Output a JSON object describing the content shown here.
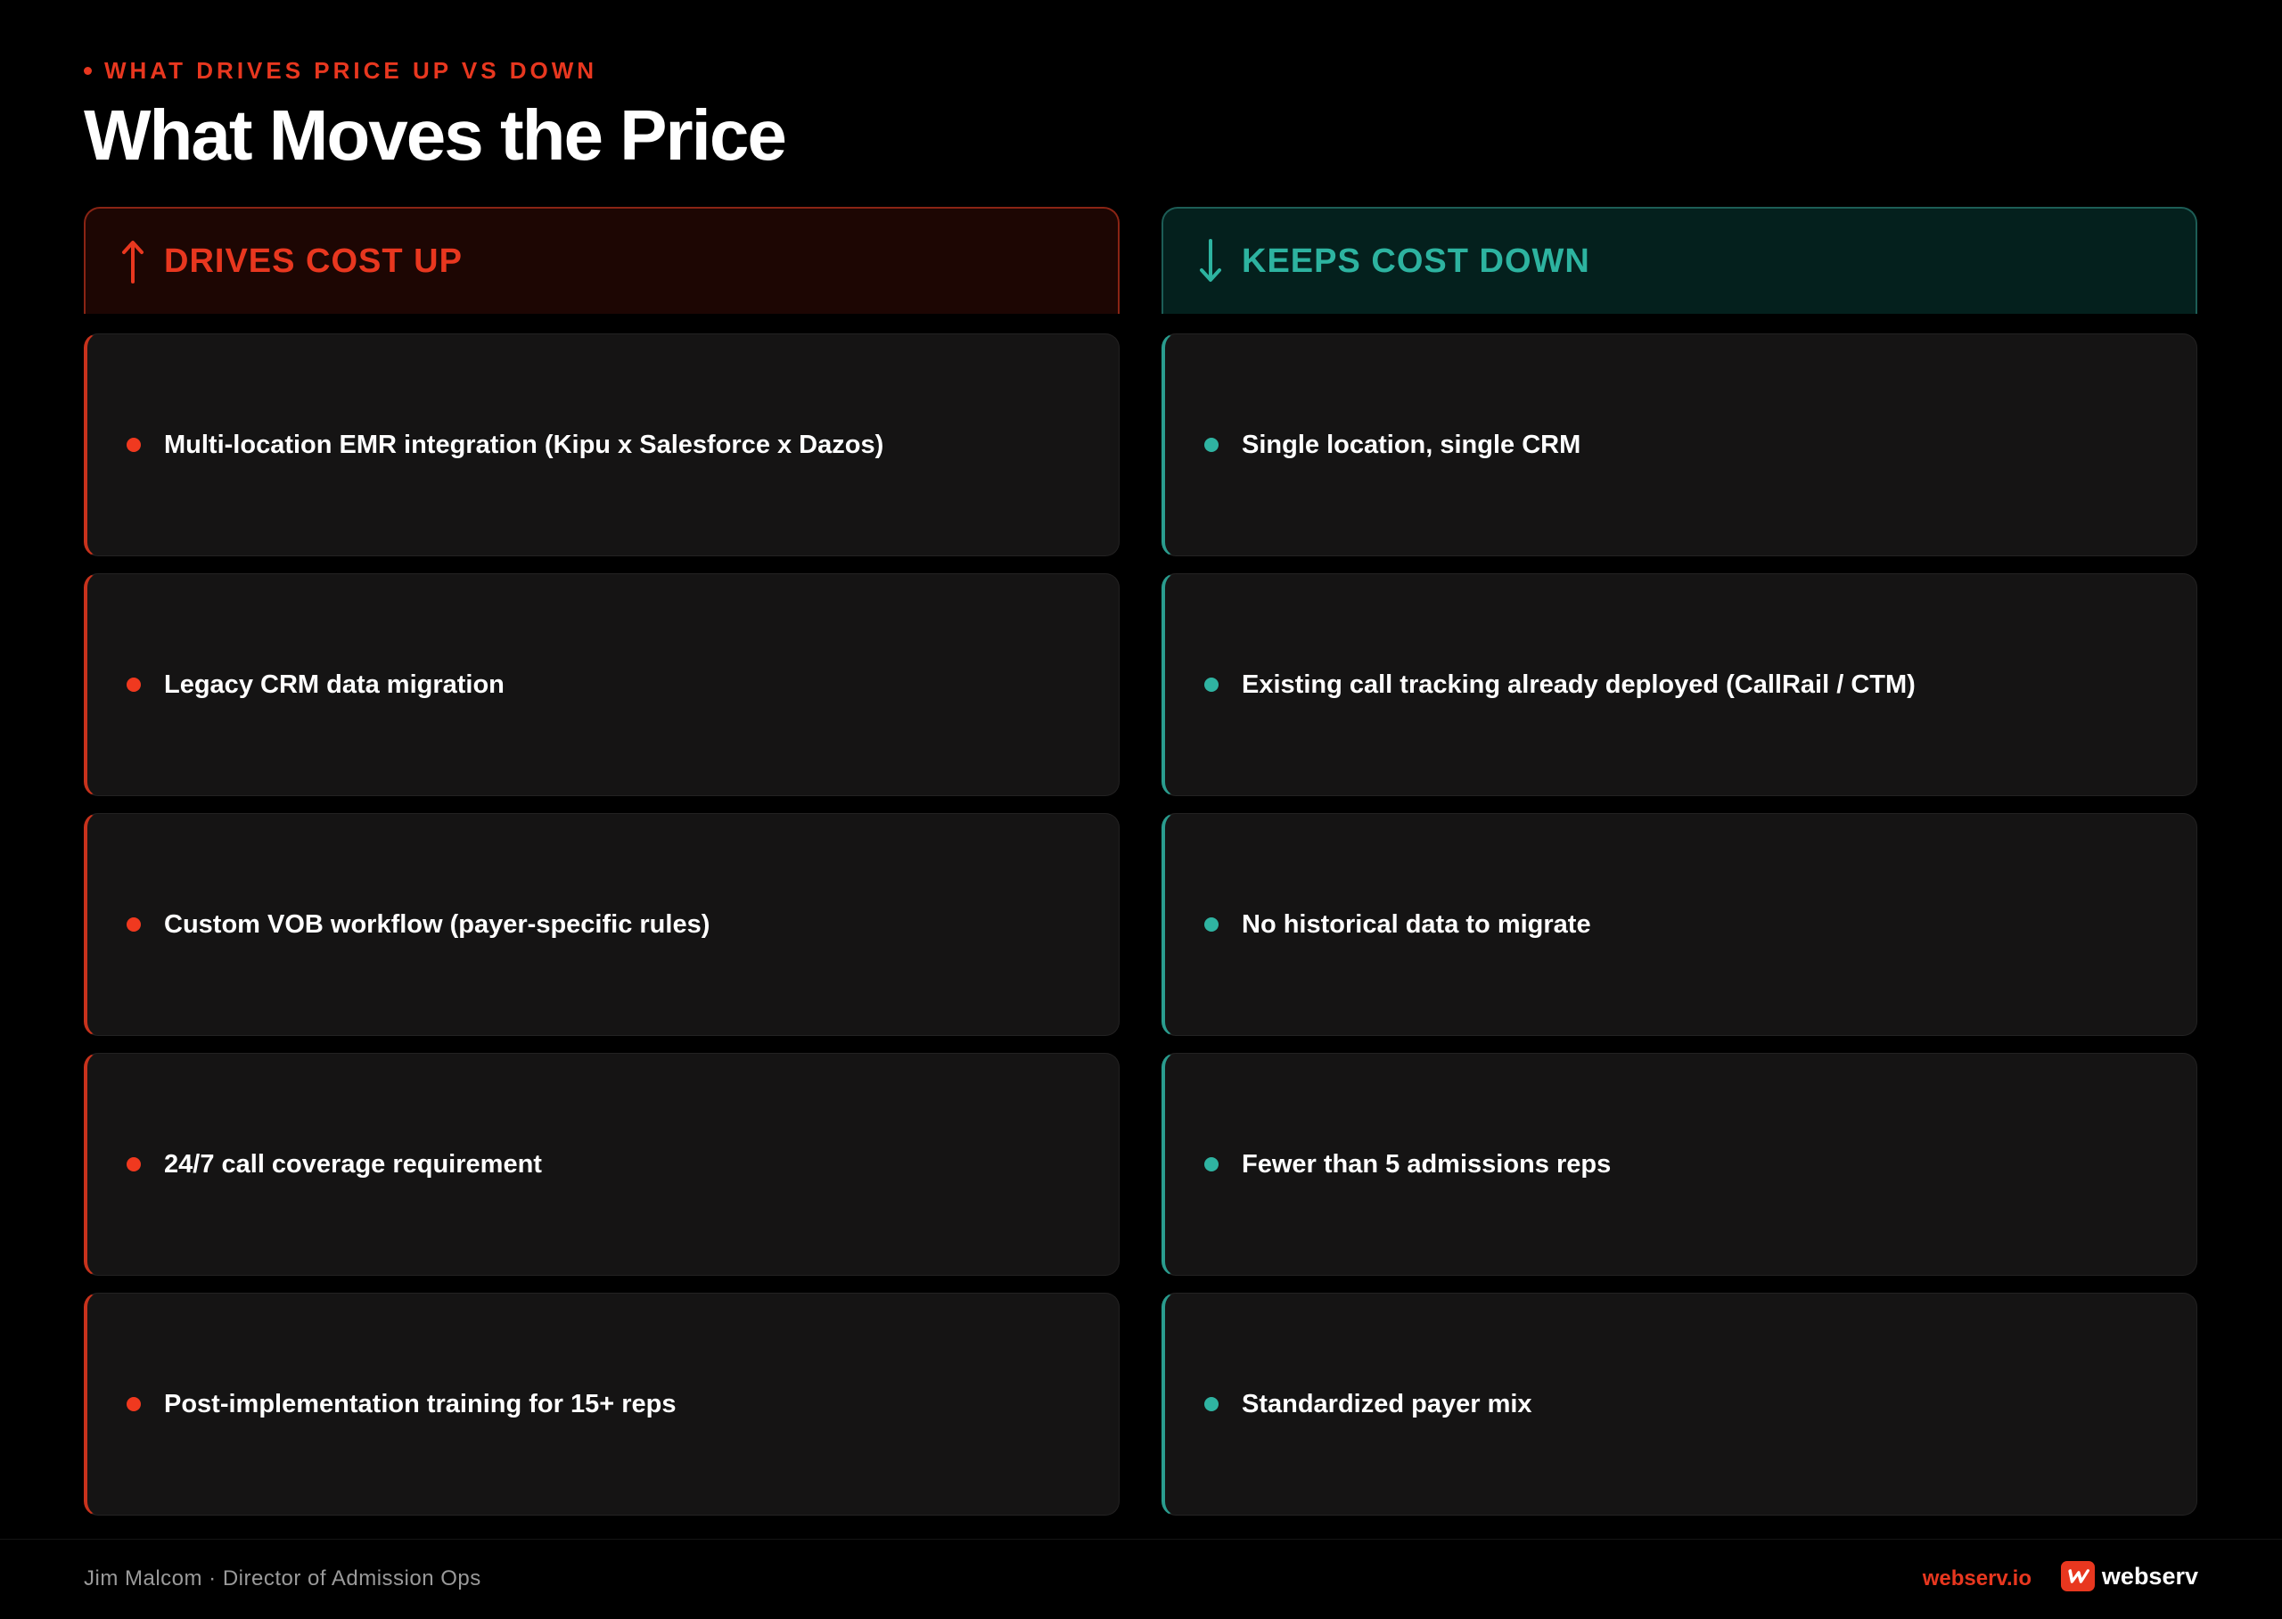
{
  "eyebrow": "WHAT DRIVES PRICE UP VS DOWN",
  "title": "What Moves the Price",
  "colors": {
    "accent_red": "#e8371f",
    "accent_teal": "#2db3a0",
    "background": "#000000",
    "card": "#151414"
  },
  "left": {
    "header": "DRIVES COST UP",
    "icon": "arrow-up-icon",
    "items": [
      "Multi-location EMR integration (Kipu x Salesforce x Dazos)",
      "Legacy CRM data migration",
      "Custom VOB workflow (payer-specific rules)",
      "24/7 call coverage requirement",
      "Post-implementation training for 15+ reps"
    ]
  },
  "right": {
    "header": "KEEPS COST DOWN",
    "icon": "arrow-down-icon",
    "items": [
      "Single location, single CRM",
      "Existing call tracking already deployed (CallRail / CTM)",
      "No historical data to migrate",
      "Fewer than 5 admissions reps",
      "Standardized payer mix"
    ]
  },
  "footer": {
    "author": "Jim Malcom · Director of Admission Ops",
    "url": "webserv.io",
    "brand": "webserv"
  }
}
